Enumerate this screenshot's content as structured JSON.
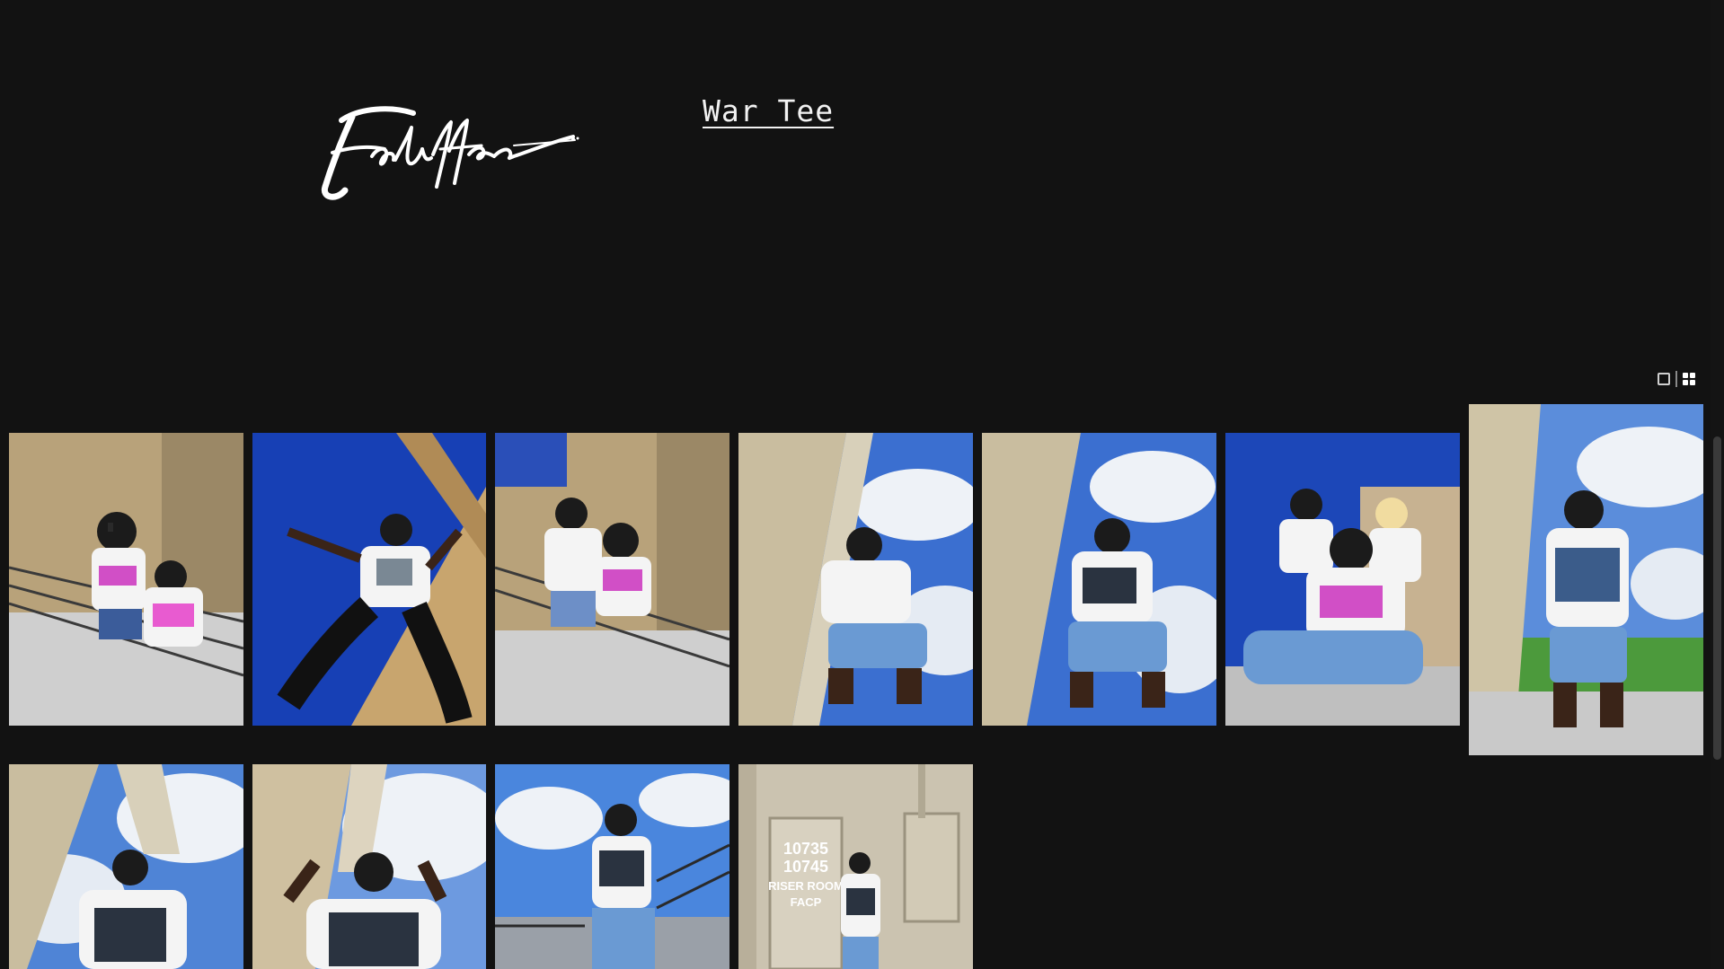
{
  "header": {
    "logo_alt": "Fndiffer signature logo",
    "title_link": "War Tee"
  },
  "view_toggle": {
    "single_icon": "single-view-icon",
    "grid_icon": "grid-view-icon",
    "active": "grid"
  },
  "gallery": {
    "photos": [
      {
        "scene": "stairwell-duo",
        "sky": "#2a4fb8",
        "wall": "#b8a27a",
        "shirt": "#f4f4f4"
      },
      {
        "scene": "jump-blue-sky",
        "sky": "#1740b5",
        "wall": "#c8a56e",
        "shirt": "#f4f4f4"
      },
      {
        "scene": "stairwell-duo-2",
        "sky": "#2a4fb8",
        "wall": "#b8a27a",
        "shirt": "#f4f4f4"
      },
      {
        "scene": "crouch-clouds",
        "sky": "#3b6fd0",
        "wall": "#c9bd9f",
        "shirt": "#f4f4f4"
      },
      {
        "scene": "crouch-clouds-2",
        "sky": "#3b6fd0",
        "wall": "#c9bd9f",
        "shirt": "#f4f4f4"
      },
      {
        "scene": "group-three",
        "sky": "#1c47b8",
        "wall": "#c7b291",
        "shirt": "#f4f4f4"
      },
      {
        "scene": "field-standing",
        "sky": "#5b8ddb",
        "wall": "#cfc4a6",
        "shirt": "#f4f4f4"
      },
      {
        "scene": "arch-clouds",
        "sky": "#4f84d6",
        "wall": "#c9bd9f",
        "shirt": "#f4f4f4"
      },
      {
        "scene": "peace-sign",
        "sky": "#6d9ae0",
        "wall": "#cfc0a0",
        "shirt": "#f4f4f4"
      },
      {
        "scene": "stairs-top",
        "sky": "#4a86dd",
        "wall": "#9aa0a8",
        "shirt": "#f4f4f4"
      },
      {
        "scene": "riser-room-door",
        "sky": "#c9c2b1",
        "wall": "#cbc3b0",
        "shirt": "#f4f4f4"
      }
    ]
  },
  "door_sign": "10735\n10745\nRISER ROOM\nFACP"
}
